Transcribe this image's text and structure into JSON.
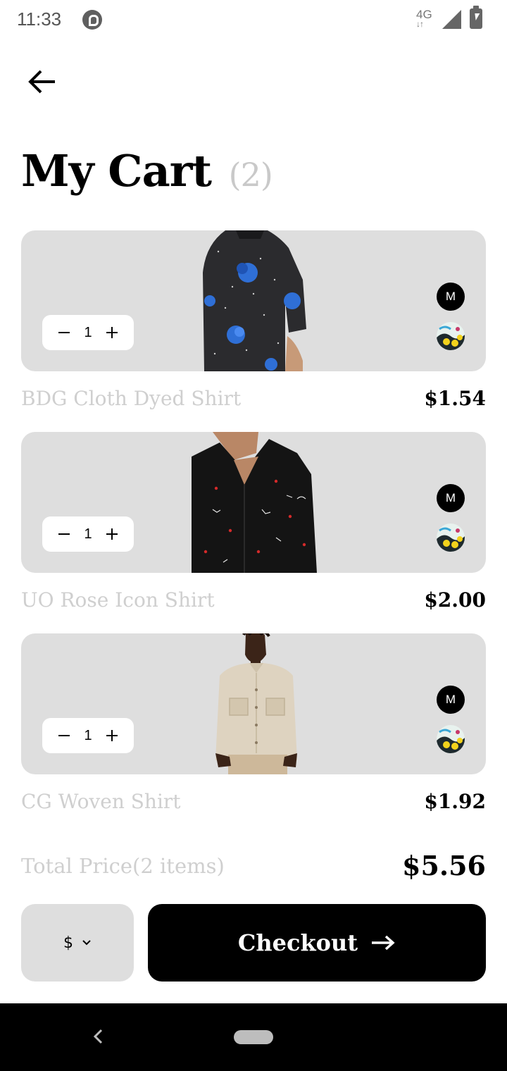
{
  "status_bar": {
    "time": "11:33",
    "network": "4G",
    "icons": [
      "app-notification-icon",
      "signal-icon",
      "battery-charging-icon"
    ]
  },
  "header": {
    "back_icon": "arrow-left-icon",
    "title": "My Cart",
    "count": "(2)"
  },
  "cart": {
    "items": [
      {
        "name": "BDG Cloth Dyed Shirt",
        "price": "$1.54",
        "quantity": "1",
        "size": "M",
        "image": "black shirt with blue flowers",
        "colors": {
          "shirt": "#2b2b2e",
          "accent": "#2f6fd6"
        }
      },
      {
        "name": "UO Rose Icon Shirt",
        "price": "$2.00",
        "quantity": "1",
        "size": "M",
        "image": "black shirt with red print",
        "colors": {
          "shirt": "#141414",
          "accent": "#d42a2a"
        }
      },
      {
        "name": "CG Woven Shirt",
        "price": "$1.92",
        "quantity": "1",
        "size": "M",
        "image": "beige shirt",
        "colors": {
          "shirt": "#ded3c0",
          "accent": "#cdb89a"
        }
      }
    ]
  },
  "summary": {
    "total_label": "Total Price(2 items)",
    "total_value": "$5.56"
  },
  "actions": {
    "currency": "$",
    "checkout_label": "Checkout"
  },
  "colors": {
    "card_bg": "#dedede",
    "muted_text": "#cfcfcf",
    "primary": "#000000"
  }
}
